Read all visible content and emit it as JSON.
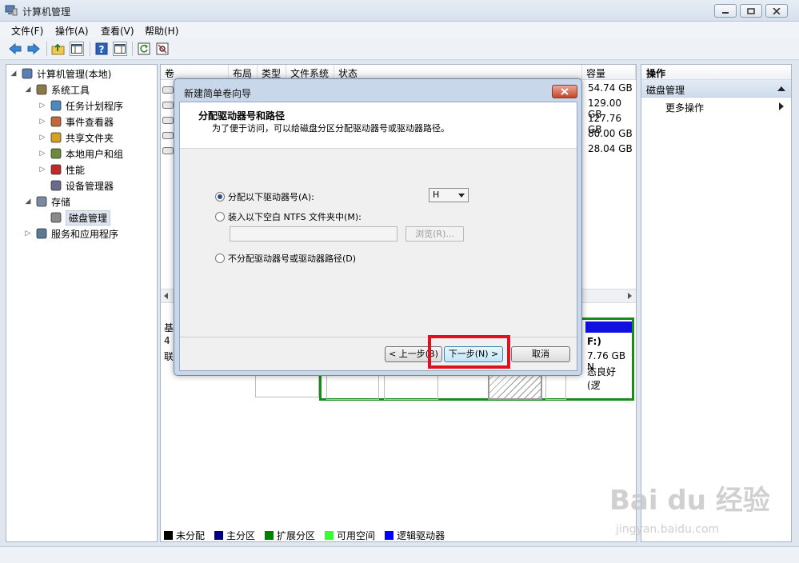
{
  "window": {
    "title": "计算机管理"
  },
  "menu": [
    "文件(F)",
    "操作(A)",
    "查看(V)",
    "帮助(H)"
  ],
  "tree": [
    {
      "label": "计算机管理(本地)",
      "depth": 0,
      "icon": "computer-icon",
      "expanded": true
    },
    {
      "label": "系统工具",
      "depth": 1,
      "icon": "tools-icon",
      "expanded": true
    },
    {
      "label": "任务计划程序",
      "depth": 2,
      "icon": "clock-icon",
      "expanded": false
    },
    {
      "label": "事件查看器",
      "depth": 2,
      "icon": "event-viewer-icon",
      "expanded": false
    },
    {
      "label": "共享文件夹",
      "depth": 2,
      "icon": "shared-folder-icon",
      "expanded": false
    },
    {
      "label": "本地用户和组",
      "depth": 2,
      "icon": "users-icon",
      "expanded": false
    },
    {
      "label": "性能",
      "depth": 2,
      "icon": "performance-icon",
      "expanded": false
    },
    {
      "label": "设备管理器",
      "depth": 2,
      "icon": "device-manager-icon",
      "expanded": null
    },
    {
      "label": "存储",
      "depth": 1,
      "icon": "storage-icon",
      "expanded": true
    },
    {
      "label": "磁盘管理",
      "depth": 2,
      "icon": "disk-icon",
      "expanded": null,
      "selected": true
    },
    {
      "label": "服务和应用程序",
      "depth": 1,
      "icon": "services-icon",
      "expanded": false
    }
  ],
  "columns": [
    "卷",
    "布局",
    "类型",
    "文件系统",
    "状态",
    "容量"
  ],
  "capacities": [
    "54.74 GB",
    "129.00 GB",
    "127.76 GB",
    "80.00 GB",
    "28.04 GB"
  ],
  "graph": {
    "left_labels": [
      "基",
      "4",
      "联"
    ],
    "right_labels": [
      "F:)",
      "7.76 GB N",
      "态良好 (逻"
    ]
  },
  "legend": [
    {
      "label": "未分配",
      "color": "#000000"
    },
    {
      "label": "主分区",
      "color": "#000080"
    },
    {
      "label": "扩展分区",
      "color": "#008000"
    },
    {
      "label": "可用空间",
      "color": "#33ff33"
    },
    {
      "label": "逻辑驱动器",
      "color": "#0000ff"
    }
  ],
  "actions": {
    "header": "操作",
    "section": "磁盘管理",
    "more": "更多操作"
  },
  "dialog": {
    "title": "新建简单卷向导",
    "heading": "分配驱动器号和路径",
    "subheading": "为了便于访问，可以给磁盘分区分配驱动器号或驱动器路径。",
    "option1": "分配以下驱动器号(A):",
    "drive_letter": "H",
    "option2": "装入以下空白 NTFS 文件夹中(M):",
    "browse": "浏览(R)...",
    "option3": "不分配驱动器号或驱动器路径(D)",
    "back": "< 上一步(B)",
    "next": "下一步(N) >",
    "cancel": "取消"
  },
  "watermark": {
    "brand": "Bai du 经验",
    "url": "jingyan.baidu.com"
  }
}
